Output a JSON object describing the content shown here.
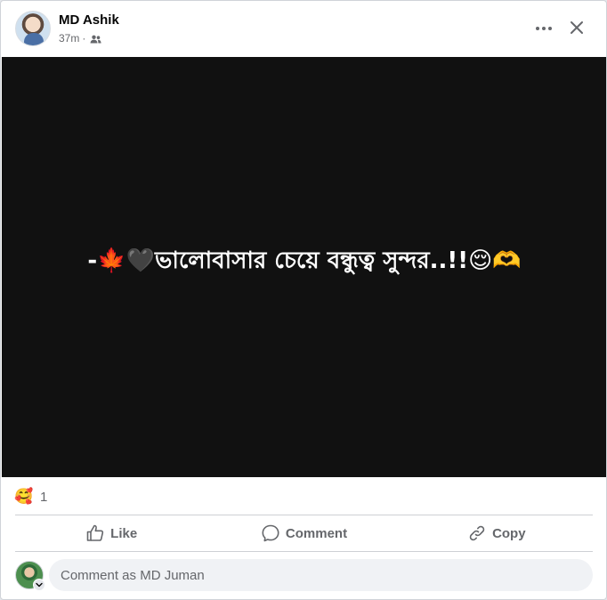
{
  "post": {
    "author": "MD Ashik",
    "time": "37m",
    "separator": "·",
    "audience_icon": "friends-icon",
    "media_text": "-🍁🖤ভালোবাসার চেয়ে বন্ধুত্ব সুন্দর..!!😌🫶"
  },
  "reactions": {
    "emoji": "🥰",
    "count": "1"
  },
  "actions": {
    "like_label": "Like",
    "comment_label": "Comment",
    "copy_label": "Copy"
  },
  "composer": {
    "placeholder": "Comment as MD Juman"
  },
  "colors": {
    "media_background": "#111111",
    "secondary_text": "#65676b",
    "comment_box": "#f0f2f5"
  }
}
